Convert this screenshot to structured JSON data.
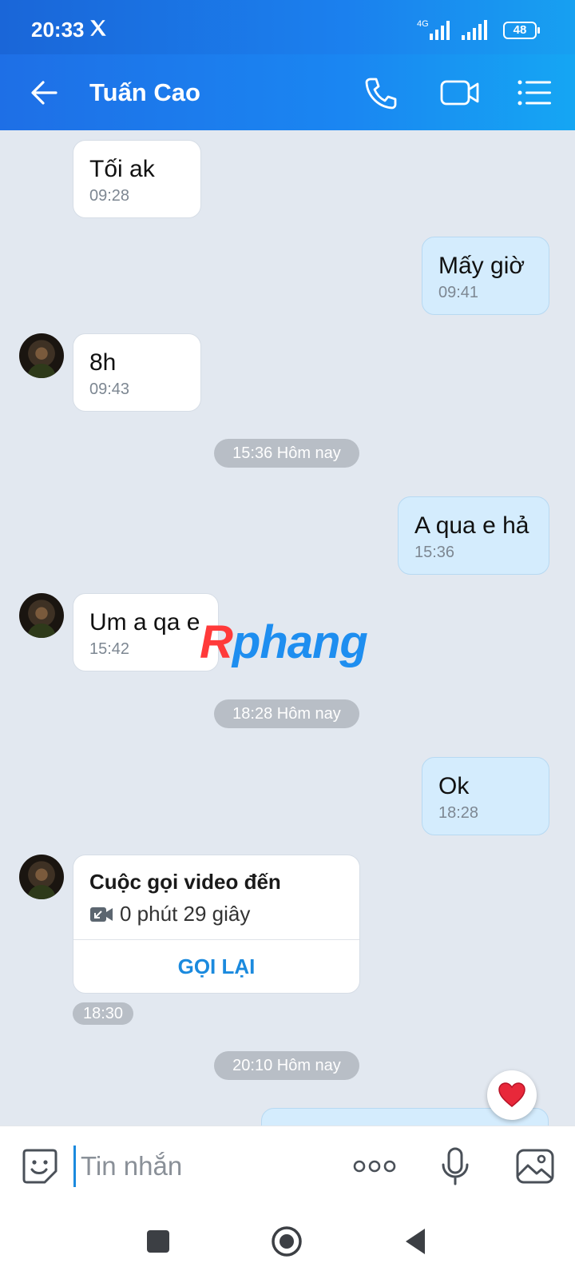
{
  "status_bar": {
    "time": "20:33",
    "network": "4G",
    "battery": "48"
  },
  "header": {
    "title": "Tuấn Cao"
  },
  "messages": [
    {
      "dir": "in",
      "text": "Tối ak",
      "time": "09:28"
    },
    {
      "dir": "out",
      "text": "Mấy giờ",
      "time": "09:41"
    },
    {
      "dir": "in",
      "text": "8h",
      "time": "09:43"
    },
    {
      "dir": "out",
      "text": "A qua e hả",
      "time": "15:36"
    },
    {
      "dir": "in",
      "text": "Um a qa e",
      "time": "15:42"
    },
    {
      "dir": "out",
      "text": "Ok",
      "time": "18:28"
    }
  ],
  "date_separators": [
    "15:36 Hôm nay",
    "18:28 Hôm nay",
    "20:10 Hôm nay"
  ],
  "call_card": {
    "title": "Cuộc gọi video đến",
    "duration": "0 phút 29 giây",
    "action": "GỌI LẠI",
    "time": "18:30"
  },
  "watermark": {
    "part1": "R",
    "part2": "phang"
  },
  "input": {
    "placeholder": "Tin nhắn"
  },
  "colors": {
    "header_start": "#1e6fe6",
    "header_end": "#15a6f3",
    "outgoing_bubble": "#d4ecfd",
    "accent": "#1b8ade"
  }
}
